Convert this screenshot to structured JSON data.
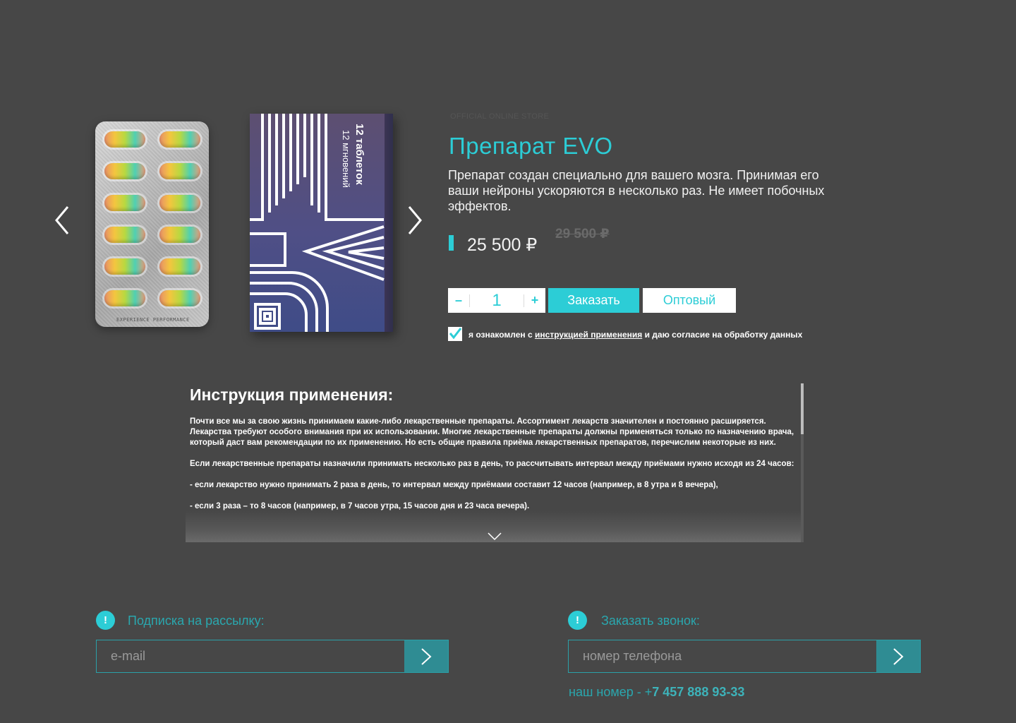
{
  "product": {
    "store_label": "OFFICIAL ONLINE STORE",
    "title": "Препарат EVO",
    "description": "Препарат создан специально для вашего мозга. Принимая его ваши нейроны ускоряются в несколько раз. Не имеет побочных эффектов.",
    "price": "25 500 ₽",
    "old_price": "29 500 ₽",
    "box_label_main": "12 таблеток",
    "box_label_sub": "12 мгновений",
    "blister_text": "EXPERIENCE PERFORMANCE"
  },
  "cart": {
    "minus": "–",
    "quantity": "1",
    "plus": "+",
    "order_label": "Заказать",
    "wholesale_label": "Оптовый"
  },
  "consent": {
    "checked": true,
    "before": "я ознакомлен с ",
    "link": "инструкцией применения",
    "after": " и даю согласие на обработку данных"
  },
  "instructions": {
    "title": "Инструкция применения:",
    "paragraphs": [
      "Почти все мы за свою жизнь принимаем какие-либо лекарственные препараты. Ассортимент лекарств значителен и постоянно расширяется. Лекарства требуют особого внимания при их использовании. Многие лекарственные препараты должны применяться только по назначению врача, который даст вам рекомендации по их применению. Но есть общие правила приёма лекарственных препаратов, перечислим некоторые из них.",
      "Если лекарственные препараты назначили принимать несколько раз в день, то рассчитывать интервал между приёмами нужно исходя из 24 часов:",
      "- если лекарство нужно принимать 2 раза в день, то интервал между приёмами составит 12 часов (например, в 8 утра и 8 вечера),",
      "- если 3 раза – то 8 часов (например, в 7 часов утра, 15 часов дня и 23 часа вечера)."
    ]
  },
  "subscribe": {
    "icon": "!",
    "label": "Подписка на рассылку:",
    "placeholder": "e-mail"
  },
  "callback": {
    "icon": "!",
    "label": "Заказать звонок:",
    "placeholder": "номер телефона",
    "phone_prefix": "наш номер - +",
    "phone_number": "7 457 888 93-33"
  },
  "colors": {
    "background": "#474747",
    "accent": "#2ccdd6",
    "accent_dark": "#2f8c93"
  }
}
